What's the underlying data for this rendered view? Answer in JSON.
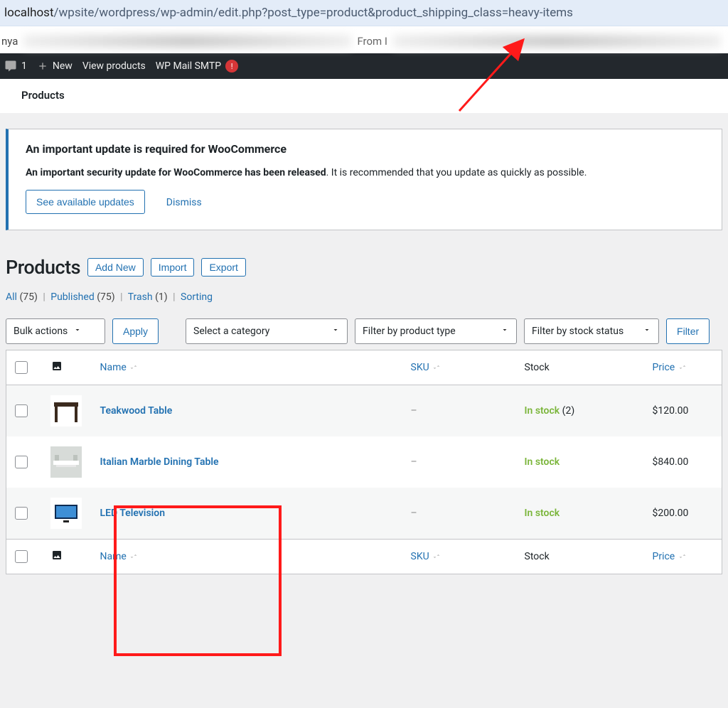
{
  "url": {
    "host": "localhost",
    "path": "/wpsite/wordpress/wp-admin/edit.php?post_type=product&product_shipping_class=heavy-items"
  },
  "nya_row": {
    "left": "nya",
    "mid": "From I"
  },
  "adminbar": {
    "comment_count": "1",
    "new": "New",
    "view_products": "View products",
    "wp_mail": "WP Mail SMTP",
    "wp_mail_badge": "!"
  },
  "page_title_bar": "Products",
  "notice": {
    "title": "An important update is required for WooCommerce",
    "body_bold": "An important security update for WooCommerce has been released",
    "body_rest": ". It is recommended that you update as quickly as possible.",
    "btn": "See available updates",
    "dismiss": "Dismiss"
  },
  "heading": {
    "title": "Products",
    "add": "Add New",
    "import": "Import",
    "export": "Export"
  },
  "subsub": {
    "all_label": "All",
    "all_count": "(75)",
    "pub_label": "Published",
    "pub_count": "(75)",
    "trash_label": "Trash",
    "trash_count": "(1)",
    "sorting": "Sorting"
  },
  "nav": {
    "bulk": "Bulk actions",
    "apply": "Apply",
    "cat": "Select a category",
    "ptype": "Filter by product type",
    "stock": "Filter by stock status",
    "filter": "Filter"
  },
  "cols": {
    "name": "Name",
    "sku": "SKU",
    "stock": "Stock",
    "price": "Price"
  },
  "rows": [
    {
      "name": "Teakwood Table",
      "sku": "–",
      "stock": "In stock",
      "stock_extra": "(2)",
      "price": "$120.00",
      "thumb": "table"
    },
    {
      "name": "Italian Marble Dining Table",
      "sku": "–",
      "stock": "In stock",
      "stock_extra": "",
      "price": "$840.00",
      "thumb": "marble"
    },
    {
      "name": "LED Television",
      "sku": "–",
      "stock": "In stock",
      "stock_extra": "",
      "price": "$200.00",
      "thumb": "tv"
    }
  ]
}
